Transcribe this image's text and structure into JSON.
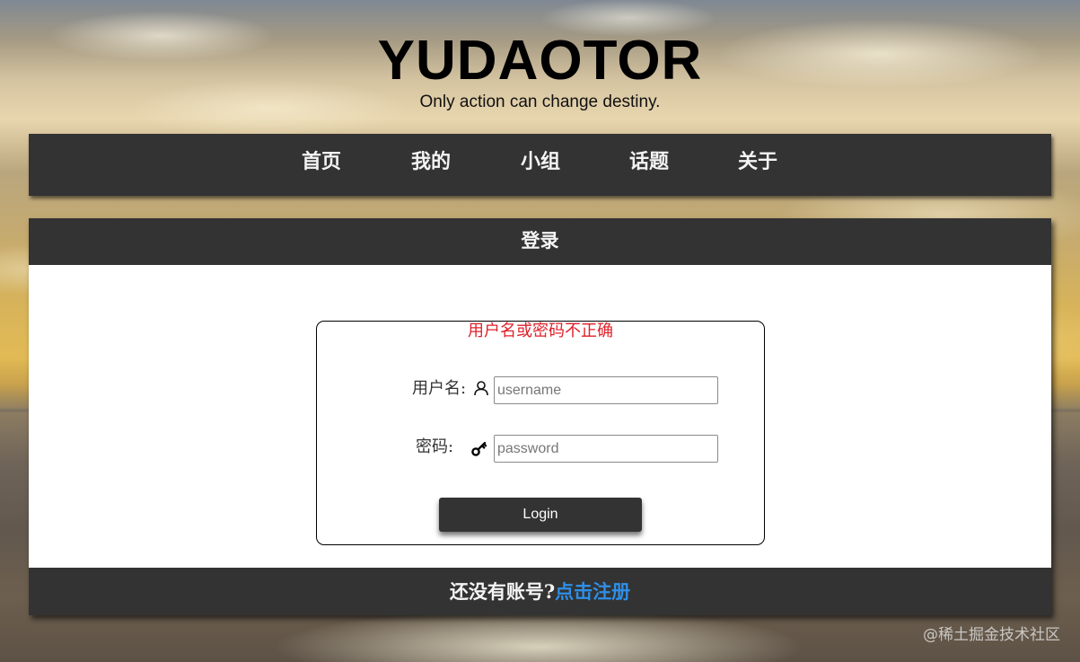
{
  "header": {
    "title": "YUDAOTOR",
    "slogan": "Only action can change destiny."
  },
  "nav": {
    "items": [
      {
        "label": "首页"
      },
      {
        "label": "我的"
      },
      {
        "label": "小组"
      },
      {
        "label": "话题"
      },
      {
        "label": "关于"
      }
    ]
  },
  "login": {
    "header_title": "登录",
    "error_message": "用户名或密码不正确",
    "username_label": "用户名:",
    "username_icon": "user-icon",
    "username_placeholder": "username",
    "password_label": "密码:",
    "password_icon": "key-icon",
    "password_placeholder": "password",
    "submit_label": "Login",
    "footer_prompt": "还没有账号?",
    "register_link": "点击注册"
  },
  "colors": {
    "dark_bar": "#333333",
    "error": "#e0202a",
    "link": "#2e8fe8"
  },
  "watermark": "@稀土掘金技术社区"
}
